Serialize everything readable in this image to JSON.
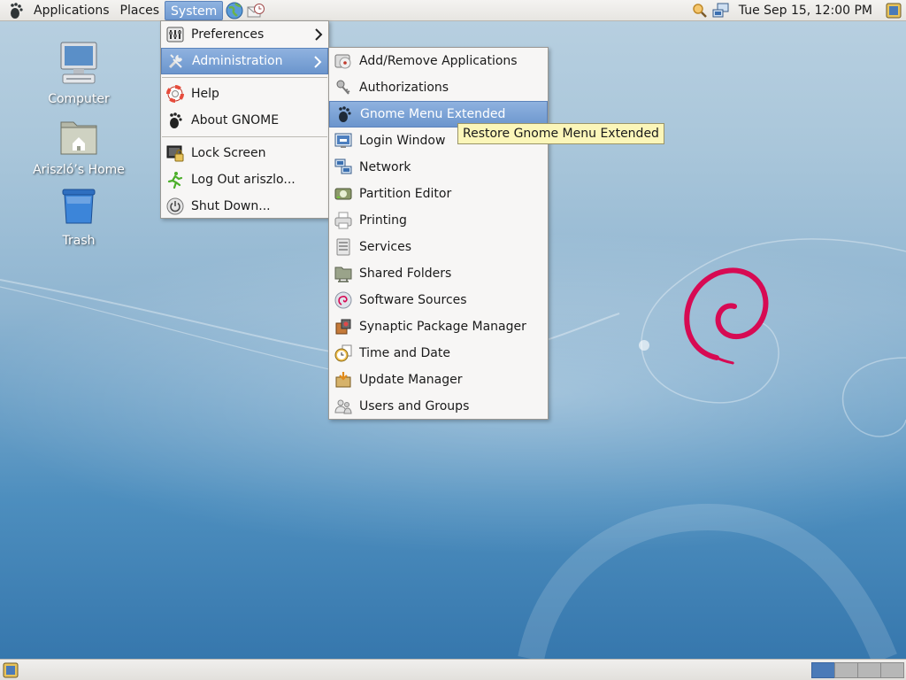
{
  "top_panel": {
    "menus": [
      "Applications",
      "Places",
      "System"
    ],
    "clock": "Tue Sep 15, 12:00 PM",
    "launchers": [
      "web-browser-icon",
      "mail-client-icon"
    ],
    "tray": [
      "search-icon",
      "network-icon",
      "notification-icon"
    ]
  },
  "desktop": {
    "icons": [
      {
        "label": "Computer",
        "icon": "computer-icon"
      },
      {
        "label": "Ariszló’s Home",
        "icon": "home-folder-icon"
      },
      {
        "label": "Trash",
        "icon": "trash-icon"
      }
    ]
  },
  "system_menu": {
    "items": [
      {
        "label": "Preferences",
        "icon": "preferences-icon",
        "submenu": true
      },
      {
        "label": "Administration",
        "icon": "tools-icon",
        "submenu": true,
        "highlighted": true
      },
      {
        "label": "Help",
        "icon": "lifebuoy-icon"
      },
      {
        "label": "About GNOME",
        "icon": "gnome-foot-icon"
      },
      {
        "label": "Lock Screen",
        "icon": "lock-screen-icon"
      },
      {
        "label": "Log Out ariszlo...",
        "icon": "logout-runner-icon"
      },
      {
        "label": "Shut Down...",
        "icon": "power-icon"
      }
    ]
  },
  "admin_menu": {
    "items": [
      {
        "label": "Add/Remove Applications",
        "icon": "package-cd-icon"
      },
      {
        "label": "Authorizations",
        "icon": "keys-icon"
      },
      {
        "label": "Gnome Menu Extended",
        "icon": "gnome-foot-icon",
        "highlighted": true
      },
      {
        "label": "Login Window",
        "icon": "login-window-icon"
      },
      {
        "label": "Network",
        "icon": "network-icon"
      },
      {
        "label": "Partition Editor",
        "icon": "disk-icon"
      },
      {
        "label": "Printing",
        "icon": "printer-icon"
      },
      {
        "label": "Services",
        "icon": "services-icon"
      },
      {
        "label": "Shared Folders",
        "icon": "shared-folder-icon"
      },
      {
        "label": "Software Sources",
        "icon": "debian-swirl-icon"
      },
      {
        "label": "Synaptic Package Manager",
        "icon": "synaptic-icon"
      },
      {
        "label": "Time and Date",
        "icon": "clock-icon"
      },
      {
        "label": "Update Manager",
        "icon": "update-icon"
      },
      {
        "label": "Users and Groups",
        "icon": "users-icon"
      }
    ]
  },
  "tooltip": {
    "text": "Restore Gnome Menu Extended"
  },
  "colors": {
    "highlight": "#6f99d1",
    "menu_bg": "#f7f6f5",
    "tooltip_bg": "#fbf6b9",
    "debian_red": "#d70a53"
  }
}
